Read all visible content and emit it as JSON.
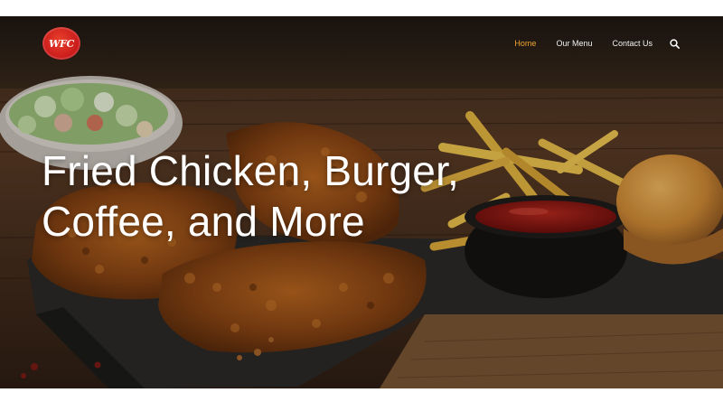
{
  "brand": {
    "logo_text": "WFC"
  },
  "nav": {
    "items": [
      {
        "label": "Home",
        "active": true
      },
      {
        "label": "Our Menu",
        "active": false
      },
      {
        "label": "Contact Us",
        "active": false
      }
    ],
    "search_icon": "search-icon",
    "active_color": "#f0a632"
  },
  "hero": {
    "headline_line1": "Fried Chicken, Burger,",
    "headline_line2": "Coffee, and More"
  },
  "colors": {
    "brand_red": "#c8181a",
    "text": "#ffffff"
  }
}
